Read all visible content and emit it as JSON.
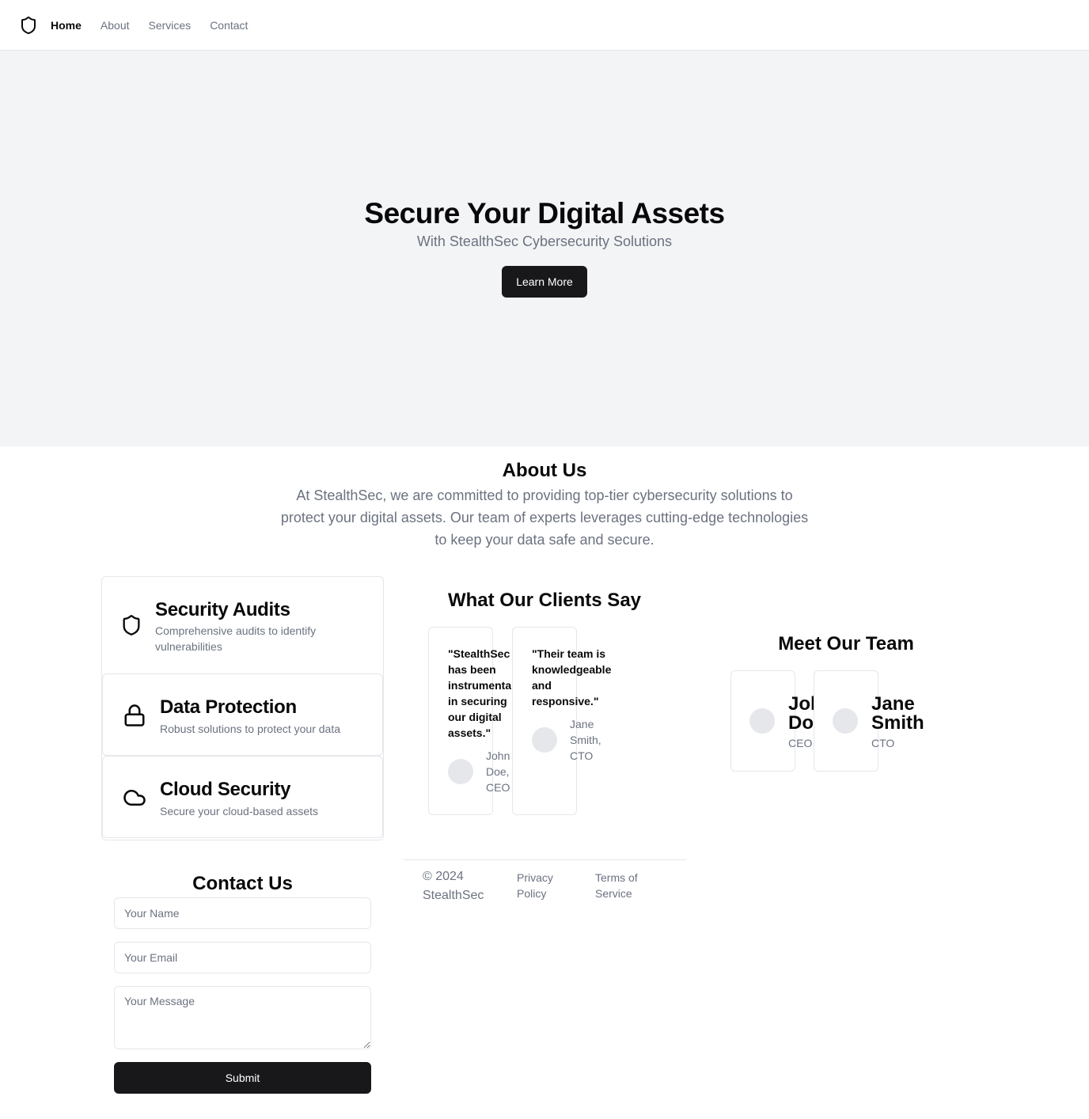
{
  "nav": {
    "logo_icon": "shield-icon",
    "items": [
      "Home",
      "About",
      "Services",
      "Contact"
    ]
  },
  "hero": {
    "title": "Secure Your Digital Assets",
    "subtitle": "With StealthSec Cybersecurity Solutions",
    "button": "Learn More"
  },
  "about": {
    "title": "About Us",
    "text": "At StealthSec, we are committed to providing top-tier cybersecurity solutions to protect your digital assets. Our team of experts leverages cutting-edge technologies to keep your data safe and secure."
  },
  "services": [
    {
      "icon": "shield-icon",
      "title": "Security Audits",
      "desc": "Comprehensive audits to identify vulnerabilities"
    },
    {
      "icon": "lock-icon",
      "title": "Data Protection",
      "desc": "Robust solutions to protect your data"
    },
    {
      "icon": "cloud-icon",
      "title": "Cloud Security",
      "desc": "Secure your cloud-based assets"
    }
  ],
  "testimonials": {
    "title": "What Our Clients Say",
    "items": [
      {
        "quote": "\"StealthSec has been instrumental in securing our digital assets.\"",
        "author": "John Doe, CEO"
      },
      {
        "quote": "\"Their team is knowledgeable and responsive.\"",
        "author": "Jane Smith, CTO"
      }
    ]
  },
  "team": {
    "title": "Meet Our Team",
    "members": [
      {
        "name": "John Doe",
        "role": "CEO"
      },
      {
        "name": "Jane Smith",
        "role": "CTO"
      }
    ]
  },
  "footer": {
    "copyright": "© 2024 StealthSec",
    "links": [
      "Privacy Policy",
      "Terms of Service"
    ]
  },
  "contact": {
    "title": "Contact Us",
    "name_placeholder": "Your Name",
    "email_placeholder": "Your Email",
    "message_placeholder": "Your Message",
    "submit": "Submit"
  }
}
